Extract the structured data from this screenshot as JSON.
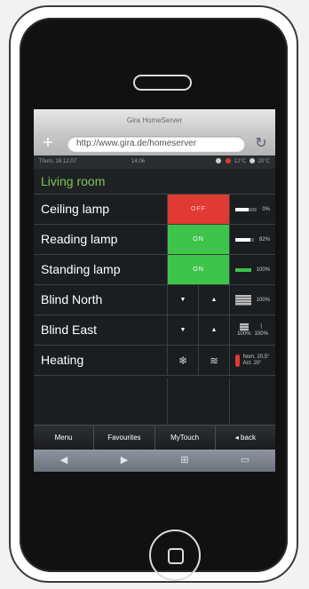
{
  "browser": {
    "title": "Gira HomeServer",
    "url": "http://www.gira.de/homeserver"
  },
  "status": {
    "date": "Thurs. 18.12.07",
    "time": "14:06",
    "temp_out": "12°C",
    "temp_in": "20°C"
  },
  "room": {
    "name": "Living room",
    "rows": [
      {
        "name": "Ceiling lamp",
        "state": "OFF",
        "level": "0%",
        "level_value": 0
      },
      {
        "name": "Reading lamp",
        "state": "ON",
        "level": "82%",
        "level_value": 82
      },
      {
        "name": "Standing lamp",
        "state": "ON",
        "level": "100%",
        "level_value": 100
      }
    ],
    "blinds": [
      {
        "name": "Blind North",
        "level": "100%"
      },
      {
        "name": "Blind East",
        "level_a": "100%",
        "level_b": "100%"
      }
    ],
    "heating": {
      "name": "Heating",
      "nom": "Nom. 20,5°",
      "act": "Act.   20°"
    }
  },
  "menu": {
    "menu": "Menu",
    "favourites": "Favourites",
    "mytouch": "MyTouch",
    "back": "back"
  }
}
